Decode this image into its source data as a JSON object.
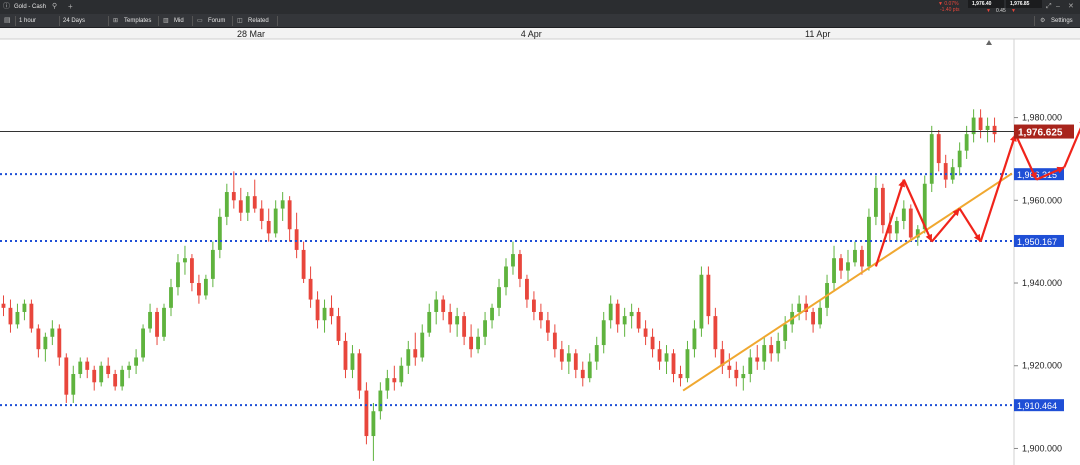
{
  "titlebar": {
    "tab_title": "Gold - Cash",
    "new_tab": "+",
    "change_pct": "▼ 0.07%",
    "change_pts": "-1.40 pts",
    "bid": "1,976.40",
    "ask": "1,976.85",
    "spread": "0.45"
  },
  "toolbar": {
    "interval": "1 hour",
    "range": "24 Days",
    "templates": "Templates",
    "mid": "Mid",
    "forum": "Forum",
    "related": "Related",
    "settings": "Settings"
  },
  "colors": {
    "up": "#5fb33e",
    "down": "#e8463c",
    "level_line": "#1f4fd6",
    "trend_line": "#f0a830",
    "arrow": "#f0241b",
    "current_price_bg": "#a8241c",
    "level_label_bg": "#1f4fd6"
  },
  "chart_data": {
    "type": "candlestick",
    "x_tick_labels": [
      "28 Mar",
      "4 Apr",
      "11 Apr"
    ],
    "y_tick_labels": [
      "1,980.000",
      "1,960.000",
      "1,940.000",
      "1,920.000",
      "1,900.000"
    ],
    "ylim": [
      1896,
      1999
    ],
    "current_price": 1976.625,
    "current_price_label": "1,976.625",
    "horizontal_levels": [
      {
        "value": 1966.315,
        "label": "1,966.315"
      },
      {
        "value": 1950.167,
        "label": "1,950.167"
      },
      {
        "value": 1910.464,
        "label": "1,910.464"
      }
    ],
    "trendline": {
      "start_price": 1914.0,
      "end_price": 1966.5
    },
    "candles": [
      [
        1935,
        1937,
        1932,
        1934
      ],
      [
        1934,
        1936,
        1928,
        1930
      ],
      [
        1930,
        1935,
        1929,
        1933
      ],
      [
        1933,
        1936,
        1931,
        1935
      ],
      [
        1935,
        1936,
        1928,
        1929
      ],
      [
        1929,
        1930,
        1922,
        1924
      ],
      [
        1924,
        1928,
        1921,
        1927
      ],
      [
        1927,
        1931,
        1925,
        1929
      ],
      [
        1929,
        1930,
        1920,
        1922
      ],
      [
        1922,
        1923,
        1911,
        1913
      ],
      [
        1913,
        1920,
        1911,
        1918
      ],
      [
        1918,
        1922,
        1917,
        1921
      ],
      [
        1921,
        1922,
        1917,
        1919
      ],
      [
        1919,
        1920,
        1914,
        1916
      ],
      [
        1916,
        1921,
        1915,
        1920
      ],
      [
        1920,
        1922,
        1917,
        1918
      ],
      [
        1918,
        1919,
        1914,
        1915
      ],
      [
        1915,
        1920,
        1914,
        1919
      ],
      [
        1919,
        1921,
        1917,
        1920
      ],
      [
        1920,
        1924,
        1918,
        1922
      ],
      [
        1922,
        1930,
        1921,
        1929
      ],
      [
        1929,
        1935,
        1928,
        1933
      ],
      [
        1933,
        1934,
        1925,
        1927
      ],
      [
        1927,
        1935,
        1926,
        1934
      ],
      [
        1934,
        1941,
        1932,
        1939
      ],
      [
        1939,
        1947,
        1937,
        1945
      ],
      [
        1945,
        1949,
        1942,
        1946
      ],
      [
        1946,
        1947,
        1938,
        1940
      ],
      [
        1940,
        1942,
        1935,
        1937
      ],
      [
        1937,
        1942,
        1936,
        1941
      ],
      [
        1941,
        1950,
        1939,
        1948
      ],
      [
        1948,
        1958,
        1946,
        1956
      ],
      [
        1956,
        1964,
        1954,
        1962
      ],
      [
        1962,
        1967,
        1958,
        1960
      ],
      [
        1960,
        1963,
        1955,
        1957
      ],
      [
        1957,
        1962,
        1955,
        1961
      ],
      [
        1961,
        1965,
        1957,
        1958
      ],
      [
        1958,
        1960,
        1953,
        1955
      ],
      [
        1955,
        1958,
        1950,
        1952
      ],
      [
        1952,
        1960,
        1951,
        1958
      ],
      [
        1958,
        1962,
        1955,
        1960
      ],
      [
        1960,
        1961,
        1950,
        1953
      ],
      [
        1953,
        1957,
        1946,
        1948
      ],
      [
        1948,
        1950,
        1940,
        1941
      ],
      [
        1941,
        1944,
        1934,
        1936
      ],
      [
        1936,
        1938,
        1929,
        1931
      ],
      [
        1931,
        1936,
        1928,
        1934
      ],
      [
        1934,
        1937,
        1930,
        1932
      ],
      [
        1932,
        1934,
        1925,
        1926
      ],
      [
        1926,
        1928,
        1917,
        1919
      ],
      [
        1919,
        1925,
        1917,
        1923
      ],
      [
        1923,
        1924,
        1912,
        1914
      ],
      [
        1914,
        1916,
        1901,
        1903
      ],
      [
        1903,
        1911,
        1897,
        1909
      ],
      [
        1909,
        1916,
        1907,
        1914
      ],
      [
        1914,
        1919,
        1912,
        1917
      ],
      [
        1917,
        1920,
        1914,
        1916
      ],
      [
        1916,
        1922,
        1915,
        1920
      ],
      [
        1920,
        1926,
        1918,
        1924
      ],
      [
        1924,
        1928,
        1920,
        1922
      ],
      [
        1922,
        1930,
        1921,
        1928
      ],
      [
        1928,
        1935,
        1927,
        1933
      ],
      [
        1933,
        1938,
        1930,
        1936
      ],
      [
        1936,
        1937,
        1931,
        1933
      ],
      [
        1933,
        1935,
        1928,
        1930
      ],
      [
        1930,
        1934,
        1927,
        1932
      ],
      [
        1932,
        1933,
        1925,
        1927
      ],
      [
        1927,
        1930,
        1922,
        1924
      ],
      [
        1924,
        1929,
        1923,
        1927
      ],
      [
        1927,
        1933,
        1925,
        1931
      ],
      [
        1931,
        1935,
        1929,
        1934
      ],
      [
        1934,
        1941,
        1932,
        1939
      ],
      [
        1939,
        1946,
        1937,
        1944
      ],
      [
        1944,
        1950,
        1942,
        1947
      ],
      [
        1947,
        1948,
        1939,
        1941
      ],
      [
        1941,
        1942,
        1934,
        1936
      ],
      [
        1936,
        1938,
        1931,
        1933
      ],
      [
        1933,
        1935,
        1929,
        1931
      ],
      [
        1931,
        1933,
        1926,
        1928
      ],
      [
        1928,
        1930,
        1922,
        1924
      ],
      [
        1924,
        1926,
        1919,
        1921
      ],
      [
        1921,
        1925,
        1918,
        1923
      ],
      [
        1923,
        1924,
        1917,
        1919
      ],
      [
        1919,
        1921,
        1915,
        1917
      ],
      [
        1917,
        1923,
        1916,
        1921
      ],
      [
        1921,
        1927,
        1919,
        1925
      ],
      [
        1925,
        1933,
        1923,
        1931
      ],
      [
        1931,
        1937,
        1929,
        1935
      ],
      [
        1935,
        1936,
        1928,
        1930
      ],
      [
        1930,
        1934,
        1927,
        1932
      ],
      [
        1932,
        1935,
        1929,
        1933
      ],
      [
        1933,
        1934,
        1928,
        1929
      ],
      [
        1929,
        1931,
        1925,
        1927
      ],
      [
        1927,
        1929,
        1922,
        1924
      ],
      [
        1924,
        1926,
        1919,
        1921
      ],
      [
        1921,
        1925,
        1918,
        1923
      ],
      [
        1923,
        1924,
        1916,
        1918
      ],
      [
        1918,
        1920,
        1915,
        1917
      ],
      [
        1917,
        1926,
        1916,
        1924
      ],
      [
        1924,
        1931,
        1922,
        1929
      ],
      [
        1929,
        1944,
        1927,
        1942
      ],
      [
        1942,
        1944,
        1930,
        1932
      ],
      [
        1932,
        1934,
        1922,
        1924
      ],
      [
        1924,
        1926,
        1918,
        1920
      ],
      [
        1920,
        1923,
        1917,
        1919
      ],
      [
        1919,
        1921,
        1915,
        1917
      ],
      [
        1917,
        1920,
        1914,
        1918
      ],
      [
        1918,
        1924,
        1916,
        1922
      ],
      [
        1922,
        1925,
        1919,
        1921
      ],
      [
        1921,
        1927,
        1919,
        1925
      ],
      [
        1925,
        1927,
        1921,
        1923
      ],
      [
        1923,
        1928,
        1921,
        1926
      ],
      [
        1926,
        1932,
        1924,
        1930
      ],
      [
        1930,
        1935,
        1928,
        1933
      ],
      [
        1933,
        1937,
        1931,
        1935
      ],
      [
        1935,
        1937,
        1931,
        1933
      ],
      [
        1933,
        1934,
        1928,
        1930
      ],
      [
        1930,
        1936,
        1929,
        1934
      ],
      [
        1934,
        1942,
        1932,
        1940
      ],
      [
        1940,
        1949,
        1938,
        1946
      ],
      [
        1946,
        1947,
        1941,
        1943
      ],
      [
        1943,
        1948,
        1940,
        1945
      ],
      [
        1945,
        1950,
        1944,
        1948
      ],
      [
        1948,
        1949,
        1942,
        1944
      ],
      [
        1944,
        1958,
        1943,
        1956
      ],
      [
        1956,
        1966,
        1954,
        1963
      ],
      [
        1963,
        1964,
        1952,
        1954
      ],
      [
        1954,
        1957,
        1950,
        1952
      ],
      [
        1952,
        1956,
        1950,
        1955
      ],
      [
        1955,
        1960,
        1953,
        1958
      ],
      [
        1958,
        1959,
        1950,
        1951
      ],
      [
        1951,
        1954,
        1949,
        1953
      ],
      [
        1953,
        1966,
        1952,
        1964
      ],
      [
        1964,
        1978,
        1962,
        1976
      ],
      [
        1976,
        1977,
        1967,
        1969
      ],
      [
        1969,
        1971,
        1963,
        1965
      ],
      [
        1965,
        1970,
        1964,
        1968
      ],
      [
        1968,
        1974,
        1966,
        1972
      ],
      [
        1972,
        1978,
        1970,
        1976
      ],
      [
        1976,
        1982,
        1974,
        1980
      ],
      [
        1980,
        1982,
        1975,
        1977
      ],
      [
        1977,
        1980,
        1974,
        1978
      ],
      [
        1978,
        1980,
        1974,
        1976
      ]
    ],
    "arrows": [
      [
        [
          125,
          1944
        ],
        [
          129,
          1965
        ],
        [
          133,
          1950
        ],
        [
          137,
          1958
        ],
        [
          140,
          1950
        ],
        [
          145,
          1976
        ],
        [
          148,
          1965
        ],
        [
          152,
          1968
        ],
        [
          155,
          1980
        ]
      ]
    ]
  }
}
